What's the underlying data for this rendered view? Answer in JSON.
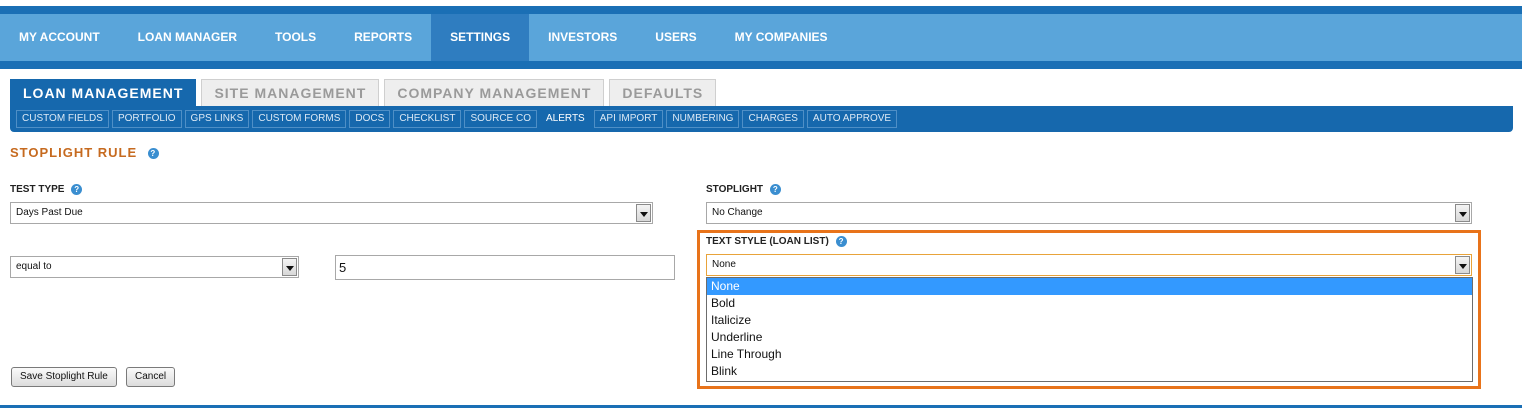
{
  "top_nav": {
    "items": [
      {
        "label": "MY ACCOUNT"
      },
      {
        "label": "LOAN MANAGER"
      },
      {
        "label": "TOOLS"
      },
      {
        "label": "REPORTS"
      },
      {
        "label": "SETTINGS",
        "active": true
      },
      {
        "label": "INVESTORS"
      },
      {
        "label": "USERS"
      },
      {
        "label": "MY COMPANIES"
      }
    ]
  },
  "tabs": [
    {
      "label": "LOAN MANAGEMENT",
      "active": true
    },
    {
      "label": "SITE MANAGEMENT"
    },
    {
      "label": "COMPANY MANAGEMENT"
    },
    {
      "label": "DEFAULTS"
    }
  ],
  "subnav": [
    {
      "label": "CUSTOM FIELDS"
    },
    {
      "label": "PORTFOLIO"
    },
    {
      "label": "GPS LINKS"
    },
    {
      "label": "CUSTOM FORMS"
    },
    {
      "label": "DOCS"
    },
    {
      "label": "CHECKLIST"
    },
    {
      "label": "SOURCE CO"
    },
    {
      "label": "ALERTS",
      "active": true
    },
    {
      "label": "API IMPORT"
    },
    {
      "label": "NUMBERING"
    },
    {
      "label": "CHARGES"
    },
    {
      "label": "AUTO APPROVE"
    }
  ],
  "section": {
    "title": "STOPLIGHT RULE",
    "help_glyph": "?"
  },
  "form": {
    "test_type": {
      "label": "TEST TYPE",
      "value": "Days Past Due"
    },
    "comparator": {
      "value": "equal to"
    },
    "amount": {
      "value": "5"
    },
    "stoplight": {
      "label": "STOPLIGHT",
      "value": "No Change"
    },
    "text_style": {
      "label": "TEXT STYLE (LOAN LIST)",
      "value": "None",
      "options": [
        "None",
        "Bold",
        "Italicize",
        "Underline",
        "Line Through",
        "Blink"
      ]
    },
    "save_label": "Save Stoplight Rule",
    "cancel_label": "Cancel"
  },
  "colors": {
    "nav_dark": "#1a6fb5",
    "nav_light": "#5aa5da",
    "accent_orange": "#e8731a",
    "section_title": "#c66a1f",
    "selected_option": "#3399ff"
  }
}
